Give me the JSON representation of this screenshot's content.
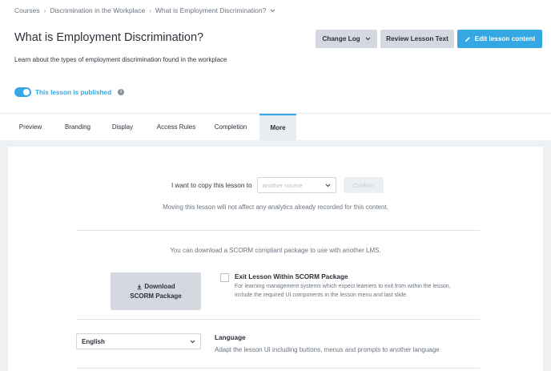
{
  "breadcrumb": {
    "items": [
      "Courses",
      "Discrimination in the Workplace",
      "What is Employment Discrimination?"
    ],
    "separator": "›",
    "chevron_icon": "chevron-down-icon"
  },
  "header": {
    "title": "What is Employment Discrimination?",
    "subtitle": "Learn about the types of employment discrimination found in the workplace",
    "change_log_label": "Change Log",
    "review_label": "Review Lesson Text",
    "edit_label": "Edit lesson content"
  },
  "publish": {
    "label": "This lesson is published",
    "enabled": true,
    "info_glyph": "i"
  },
  "tabs": [
    {
      "label": "Preview",
      "active": false
    },
    {
      "label": "Branding",
      "active": false
    },
    {
      "label": "Display",
      "active": false
    },
    {
      "label": "Access Rules",
      "active": false
    },
    {
      "label": "Completion",
      "active": false
    },
    {
      "label": "More",
      "active": true
    }
  ],
  "copy": {
    "label": "I want to copy this lesson to",
    "select_placeholder": "another course",
    "confirm_label": "Confirm",
    "note": "Moving this lesson will not affect any analytics already recorded for this content."
  },
  "scorm": {
    "note": "You can download a SCORM compliant package to use with another LMS.",
    "download_line1": "Download",
    "download_line2": "SCORM Package",
    "exit_title": "Exit Lesson Within SCORM Package",
    "exit_checked": false,
    "exit_desc": "For learning management systems which expect learners to exit from within the lesson, include the required UI components in the lesson menu and last slide."
  },
  "language": {
    "selected": "English",
    "title": "Language",
    "desc": "Adapt the lesson UI including buttons, menus and prompts to another language"
  },
  "colors": {
    "accent": "#35a8e4",
    "grey_button": "#d3d9de",
    "content_bg": "#eef1f4"
  }
}
